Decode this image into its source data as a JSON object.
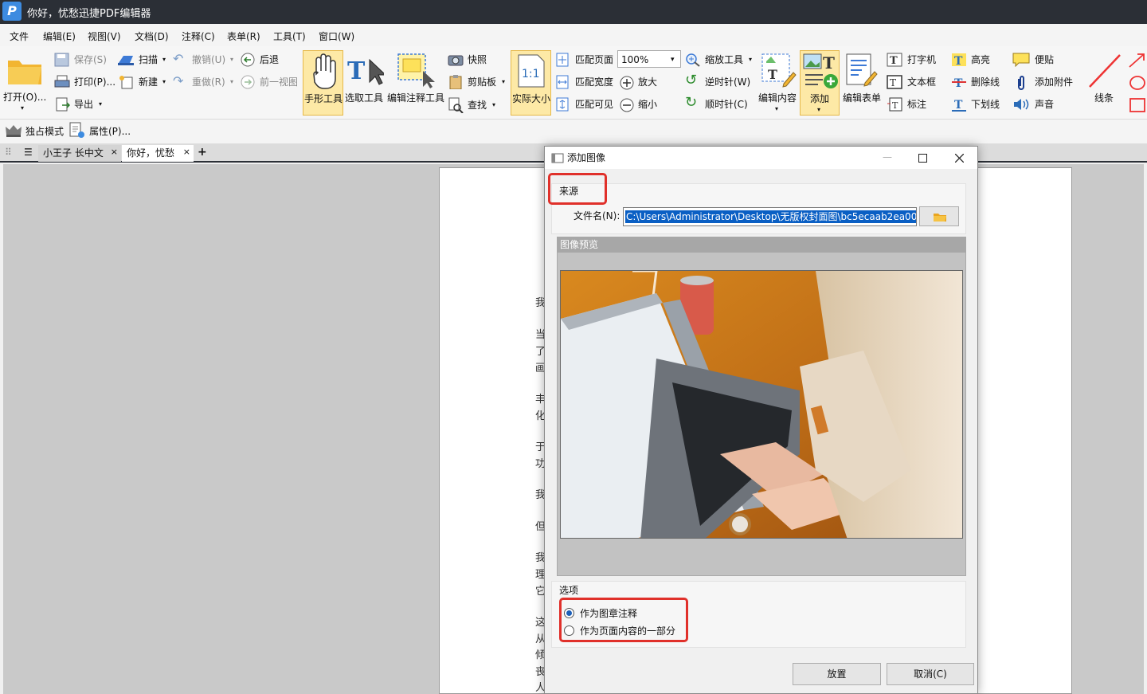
{
  "app": {
    "logo": "P",
    "title": "你好，忧愁迅捷PDF编辑器"
  },
  "menu": [
    "文件",
    "编辑(E)",
    "视图(V)",
    "文档(D)",
    "注释(C)",
    "表单(R)",
    "工具(T)",
    "窗口(W)"
  ],
  "ribbon": {
    "open": "打开(O)...",
    "save": "保存(S)",
    "print": "打印(P)...",
    "export": "导出",
    "scan": "扫描",
    "new": "新建",
    "undo": "撤销(U)",
    "redo": "重做(R)",
    "back": "后退",
    "prev_view": "前一视图",
    "hand": "手形工具",
    "select": "选取工具",
    "edit_annot": "编辑注释工具",
    "snapshot": "快照",
    "clipboard": "剪贴板",
    "find": "查找",
    "actual_size": "实际大小",
    "actual_icon": "1:1",
    "fit_page": "匹配页面",
    "fit_width": "匹配宽度",
    "fit_visible": "匹配可见",
    "zoom_value": "100%",
    "zoom_in": "放大",
    "zoom_out": "缩小",
    "zoom_tool": "缩放工具",
    "ccw": "逆时针(W)",
    "cw": "顺时针(C)",
    "edit_content": "编辑内容",
    "add": "添加",
    "edit_form": "编辑表单",
    "typewriter": "打字机",
    "textbox": "文本框",
    "callout": "标注",
    "highlight": "高亮",
    "strike": "删除线",
    "underline": "下划线",
    "note": "便贴",
    "attach": "添加附件",
    "sound": "声音",
    "lines": "线条",
    "exclusive": "独占模式",
    "properties": "属性(P)..."
  },
  "tabs": [
    {
      "label": "小王子 长中文",
      "active": false
    },
    {
      "label": "你好，忧愁",
      "active": true
    }
  ],
  "page_chars": [
    "我",
    "当",
    "了",
    "画",
    "丰",
    "化",
    "于",
    "功",
    "我",
    "但",
    "我",
    "理",
    "它",
    "这",
    "从",
    "倾",
    "丧",
    "人"
  ],
  "dialog": {
    "title": "添加图像",
    "source_label": "来源",
    "filename_label": "文件名(N):",
    "filename_value": "C:\\Users\\Administrator\\Desktop\\无版权封面图\\bc5ecaab2ea00",
    "preview_label": "图像预览",
    "options_label": "选项",
    "option_stamp": "作为图章注释",
    "option_content": "作为页面内容的一部分",
    "place_btn": "放置",
    "cancel_btn": "取消(C)"
  },
  "colors": {
    "accent": "#3d8be0",
    "highlight_box": "#e0302a",
    "selected_tool": "#fde9a6"
  }
}
